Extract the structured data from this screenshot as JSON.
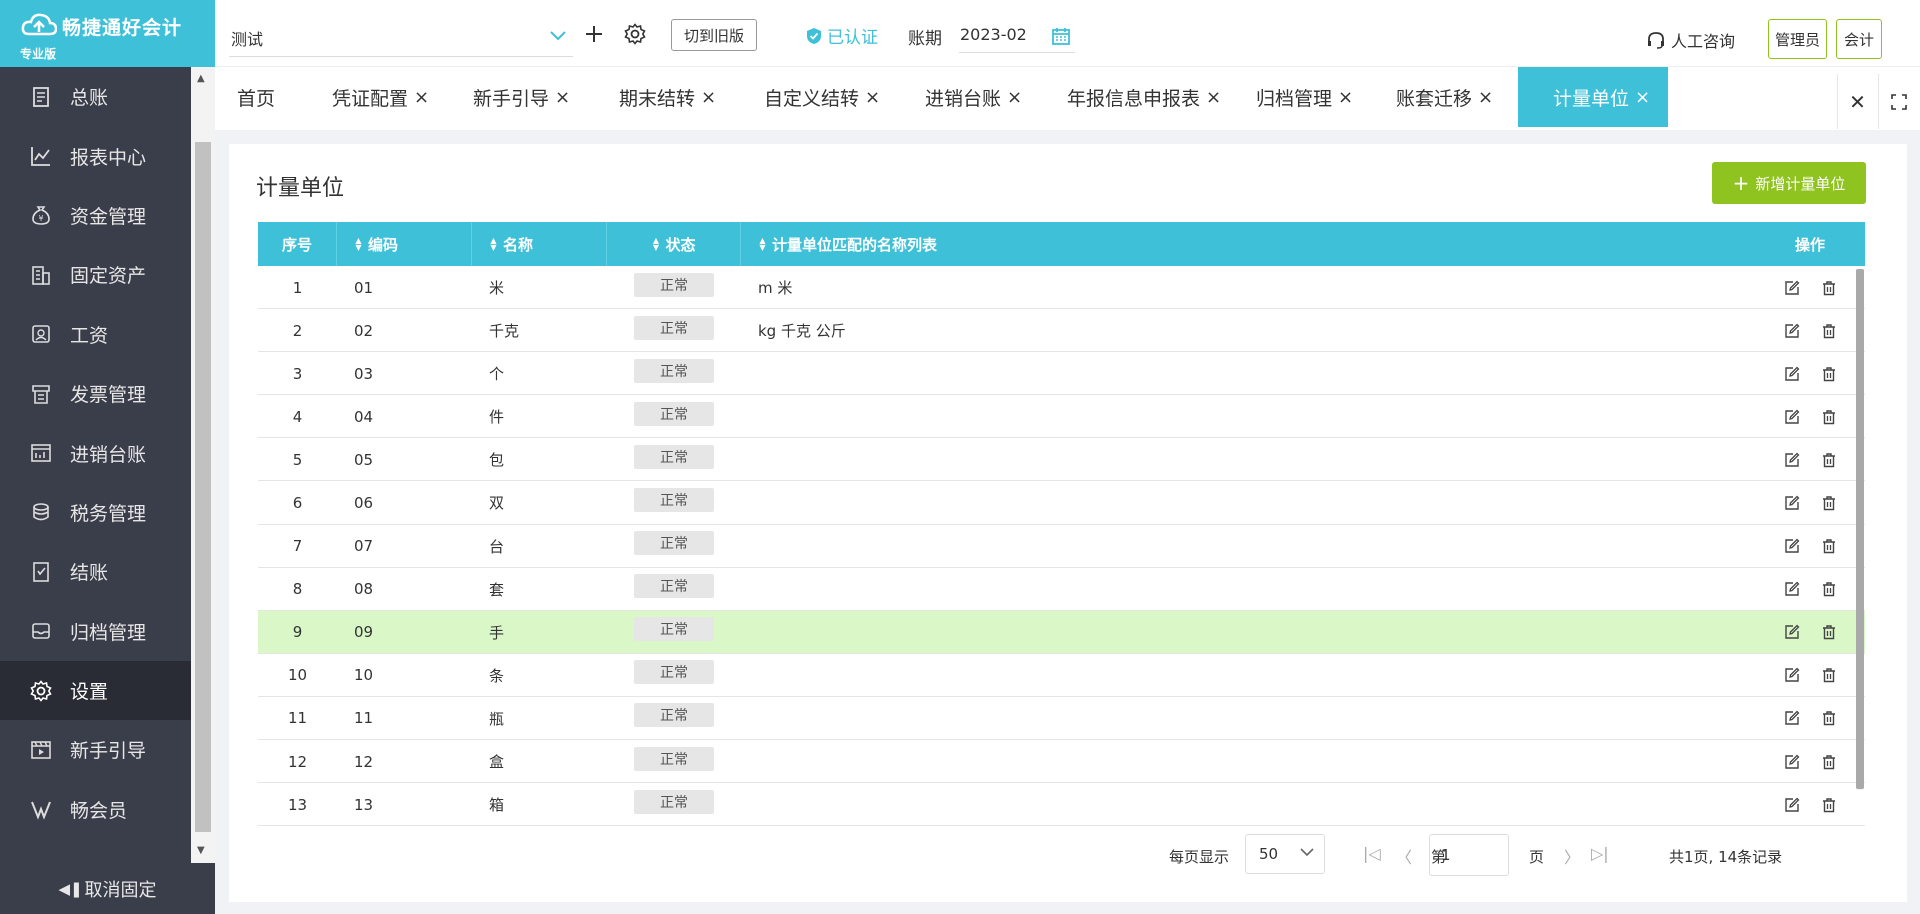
{
  "brand": {
    "name": "畅捷通好会计",
    "edition": "专业版"
  },
  "sidebar": {
    "items": [
      {
        "label": "总账",
        "icon": "ledger-icon"
      },
      {
        "label": "报表中心",
        "icon": "chart-icon"
      },
      {
        "label": "资金管理",
        "icon": "money-bag-icon"
      },
      {
        "label": "固定资产",
        "icon": "building-icon"
      },
      {
        "label": "工资",
        "icon": "salary-icon"
      },
      {
        "label": "发票管理",
        "icon": "invoice-icon"
      },
      {
        "label": "进销台账",
        "icon": "inventory-icon"
      },
      {
        "label": "税务管理",
        "icon": "tax-icon"
      },
      {
        "label": "结账",
        "icon": "close-book-icon"
      },
      {
        "label": "归档管理",
        "icon": "archive-icon"
      },
      {
        "label": "设置",
        "icon": "gear-icon",
        "active": true
      },
      {
        "label": "新手引导",
        "icon": "video-icon"
      },
      {
        "label": "畅会员",
        "icon": "vip-icon"
      }
    ],
    "unpin_label": "取消固定"
  },
  "topbar": {
    "company": "测试",
    "switch_old_label": "切到旧版",
    "verified_label": "已认证",
    "period_label": "账期",
    "period_value": "2023-02",
    "consult_label": "人工咨询",
    "admin_label": "管理员",
    "accountant_label": "会计"
  },
  "tabs": [
    {
      "label": "首页",
      "closable": false
    },
    {
      "label": "凭证配置",
      "closable": true
    },
    {
      "label": "新手引导",
      "closable": true
    },
    {
      "label": "期末结转",
      "closable": true
    },
    {
      "label": "自定义结转",
      "closable": true
    },
    {
      "label": "进销台账",
      "closable": true
    },
    {
      "label": "年报信息申报表",
      "closable": true
    },
    {
      "label": "归档管理",
      "closable": true
    },
    {
      "label": "账套迁移",
      "closable": true
    },
    {
      "label": "计量单位",
      "closable": true,
      "active": true
    }
  ],
  "main": {
    "title": "计量单位",
    "add_button_label": "新增计量单位",
    "columns": [
      "序号",
      "编码",
      "名称",
      "状态",
      "计量单位匹配的名称列表",
      "操作"
    ],
    "rows": [
      {
        "no": "1",
        "code": "01",
        "name": "米",
        "status": "正常",
        "aliases": "m 米"
      },
      {
        "no": "2",
        "code": "02",
        "name": "千克",
        "status": "正常",
        "aliases": "kg 千克 公斤"
      },
      {
        "no": "3",
        "code": "03",
        "name": "个",
        "status": "正常",
        "aliases": ""
      },
      {
        "no": "4",
        "code": "04",
        "name": "件",
        "status": "正常",
        "aliases": ""
      },
      {
        "no": "5",
        "code": "05",
        "name": "包",
        "status": "正常",
        "aliases": ""
      },
      {
        "no": "6",
        "code": "06",
        "name": "双",
        "status": "正常",
        "aliases": ""
      },
      {
        "no": "7",
        "code": "07",
        "name": "台",
        "status": "正常",
        "aliases": ""
      },
      {
        "no": "8",
        "code": "08",
        "name": "套",
        "status": "正常",
        "aliases": ""
      },
      {
        "no": "9",
        "code": "09",
        "name": "手",
        "status": "正常",
        "aliases": "",
        "highlighted": true
      },
      {
        "no": "10",
        "code": "10",
        "name": "条",
        "status": "正常",
        "aliases": ""
      },
      {
        "no": "11",
        "code": "11",
        "name": "瓶",
        "status": "正常",
        "aliases": ""
      },
      {
        "no": "12",
        "code": "12",
        "name": "盒",
        "status": "正常",
        "aliases": ""
      },
      {
        "no": "13",
        "code": "13",
        "name": "箱",
        "status": "正常",
        "aliases": ""
      }
    ]
  },
  "pagination": {
    "per_page_label": "每页显示",
    "per_page_value": "50",
    "page_prefix": "第",
    "page_value": "1",
    "page_suffix": "页",
    "summary": "共1页, 14条记录"
  },
  "colors": {
    "accent": "#3ec0d8",
    "green": "#8fc31f",
    "sidebar": "#3a3d4a",
    "row_highlight": "#daf7c7"
  }
}
